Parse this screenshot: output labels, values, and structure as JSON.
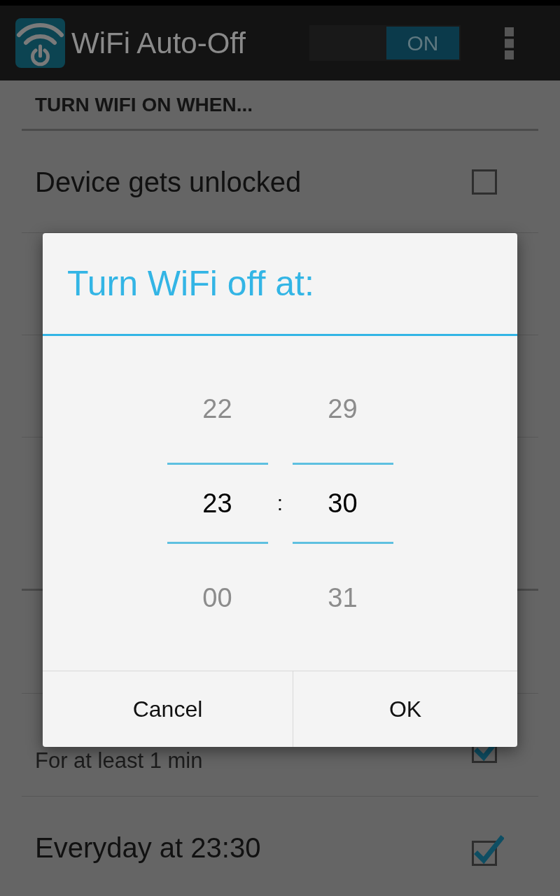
{
  "action_bar": {
    "title": "WiFi Auto-Off",
    "toggle": {
      "label": "ON",
      "on": true
    }
  },
  "settings": [
    {
      "header": "TURN WIFI ON WHEN...",
      "rows": [
        {
          "title": "Device gets unlocked",
          "checked": false
        }
      ]
    },
    {
      "rows": [
        {
          "subtitle": "For at least 1 min",
          "checked": true
        },
        {
          "title": "Everyday at 23:30",
          "checked": true
        }
      ]
    }
  ],
  "dialog": {
    "title": "Turn WiFi off at:",
    "separator": ":",
    "columns": [
      {
        "items": [
          {
            "value": "22",
            "selected": false
          },
          {
            "value": "23",
            "selected": true
          },
          {
            "value": "00",
            "selected": false
          }
        ]
      },
      {
        "items": [
          {
            "value": "29",
            "selected": false
          },
          {
            "value": "30",
            "selected": true
          },
          {
            "value": "31",
            "selected": false
          }
        ]
      }
    ],
    "buttons": [
      "Cancel",
      "OK"
    ]
  }
}
